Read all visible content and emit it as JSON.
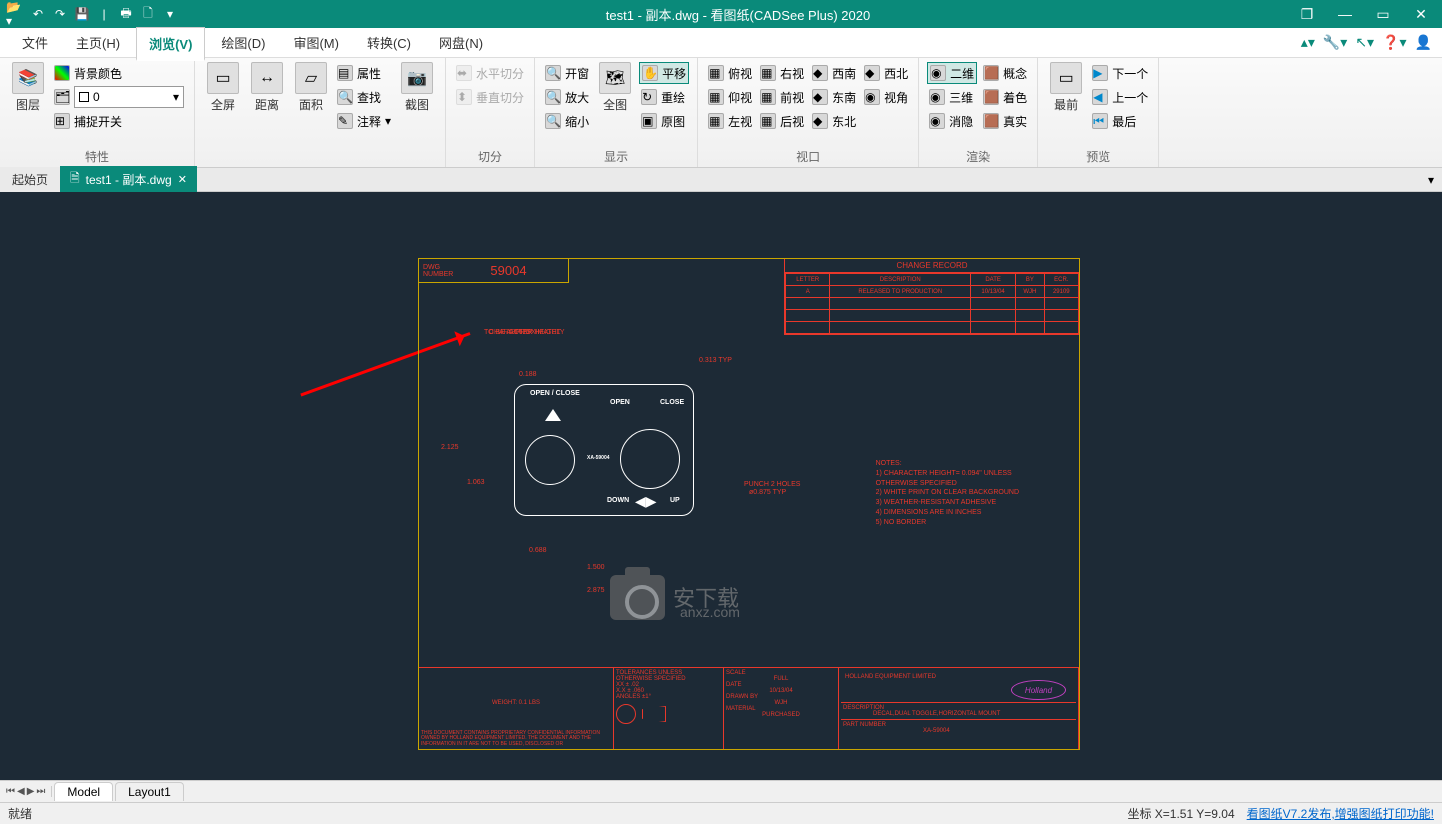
{
  "title": "test1 - 副本.dwg - 看图纸(CADSee Plus) 2020",
  "menu": {
    "file": "文件",
    "main": "主页(H)",
    "view": "浏览(V)",
    "draw": "绘图(D)",
    "review": "审图(M)",
    "convert": "转换(C)",
    "cloud": "网盘(N)"
  },
  "ribbon": {
    "g1": {
      "layer": "图层",
      "bgcolor": "背景颜色",
      "layer0": "0",
      "capture": "捕捉开关",
      "label": "特性"
    },
    "g2": {
      "full": "全屏",
      "dist": "距离",
      "area": "面积",
      "attr": "属性",
      "find": "查找",
      "annot": "注释",
      "crop": "截图"
    },
    "g3": {
      "hsplit": "水平切分",
      "vsplit": "垂直切分",
      "label": "切分"
    },
    "g4": {
      "openwin": "开窗",
      "zoomin": "放大",
      "zoomout": "缩小",
      "all": "全图",
      "pan": "平移",
      "redraw": "重绘",
      "orig": "原图",
      "label": "显示"
    },
    "g5": {
      "r1c1": "俯视",
      "r1c2": "右视",
      "r1c3": "西南",
      "r1c4": "西北",
      "r2c1": "仰视",
      "r2c2": "前视",
      "r2c3": "东南",
      "r2c4": "视角",
      "r3c1": "左视",
      "r3c2": "后视",
      "r3c3": "东北",
      "label": "视口"
    },
    "g6": {
      "r1c1": "二维",
      "r1c2": "概念",
      "r2c1": "三维",
      "r2c2": "着色",
      "r3c1": "消隐",
      "r3c2": "真实",
      "label": "渲染"
    },
    "g7": {
      "front": "最前",
      "next": "下一个",
      "prev": "上一个",
      "last": "最后",
      "label": "预览"
    }
  },
  "tabs": {
    "start": "起始页",
    "file": "test1 - 副本.dwg"
  },
  "dwg": {
    "numlbl": "DWG NUMBER",
    "num": "59004",
    "change": {
      "title": "CHANGE RECORD",
      "h": [
        "LETTER",
        "DESCRIPTION",
        "DATE",
        "BY",
        "ECR."
      ],
      "r": [
        "A",
        "RELEASED TO PRODUCTION",
        "10/13/04",
        "WJH",
        "29109"
      ]
    },
    "charnote1": "CHARACTER HEIGHT",
    "charnote2": "TO BE APPROXIMATELY",
    "charnote3": "0.0625\"",
    "d188": "0.188",
    "d313": "0.313 TYP",
    "d2125": "2.125",
    "d1063": "1.063",
    "d0688": "0.688",
    "d1500": "1.500",
    "d2875": "2.875",
    "openClose": "OPEN / CLOSE",
    "open": "OPEN",
    "close": "CLOSE",
    "down": "DOWN",
    "up": "UP",
    "xa": "XA-59004",
    "punch1": "PUNCH 2 HOLES",
    "punch2": "ø0.875 TYP",
    "notesTitle": "NOTES:",
    "n1": "1) CHARACTER HEIGHT= 0.094\" UNLESS",
    "n1b": "OTHERWISE SPECIFIED",
    "n2": "2) WHITE PRINT ON CLEAR BACKGROUND",
    "n3": "3) WEATHER-RESISTANT ADHESIVE",
    "n4": "4) DIMENSIONS ARE IN INCHES",
    "n5": "5) NO BORDER",
    "weight": "WEIGHT: 0.1 LBS",
    "tol1": "TOLERANCES UNLESS",
    "tol2": "OTHERWISE SPECIFIED",
    "tol3": "XX ± .02",
    "tol4": "X.X ± .060",
    "tol5": "ANGLES ±1°",
    "scale": "SCALE",
    "scaleval": "FULL",
    "date": "DATE",
    "dateval": "10/13/04",
    "drawn": "DRAWN BY",
    "drawnval": "WJH",
    "material": "MATERIAL",
    "materialval": "PURCHASED",
    "company": "HOLLAND EQUIPMENT LIMITED",
    "brand": "Holland",
    "desc": "DESCRIPTION",
    "descval": "DECAL,DUAL TOGGLE,HORIZONTAL MOUNT",
    "partno": "PART NUMBER",
    "partnoval": "XA-59004",
    "prop": "THIS DOCUMENT CONTAINS PROPRIETARY CONFIDENTIAL INFORMATION OWNED BY HOLLAND EQUIPMENT LIMITED. THE DOCUMENT AND THE INFORMATION IN IT ARE NOT TO BE USED, DISCLOSED OR"
  },
  "wm": {
    "txt": "安下载",
    "dom": "anxz.com"
  },
  "layouts": {
    "model": "Model",
    "layout1": "Layout1"
  },
  "status": {
    "ready": "就绪",
    "coord": "坐标 X=1.51 Y=9.04",
    "link": "看图纸V7.2发布,增强图纸打印功能!"
  }
}
